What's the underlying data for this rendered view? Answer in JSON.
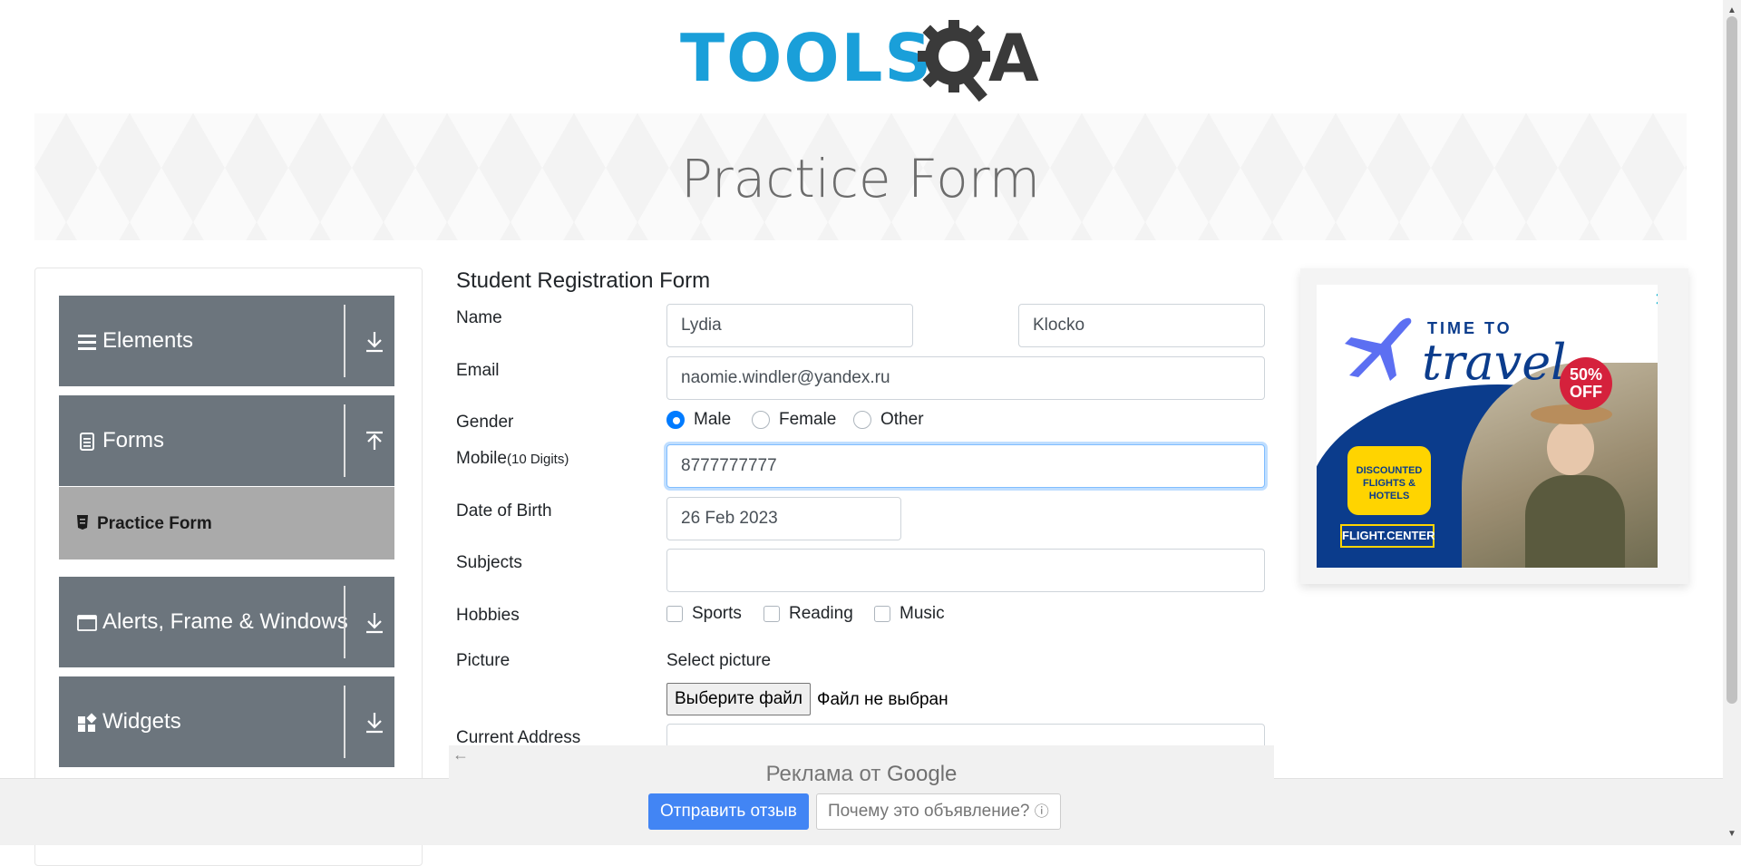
{
  "header": {
    "logo_main": "TOOLS",
    "logo_end": "A"
  },
  "banner": {
    "title": "Practice Form"
  },
  "sidebar": {
    "groups": [
      {
        "label": "Elements",
        "icon": "list-icon",
        "expanded": false
      },
      {
        "label": "Forms",
        "icon": "document-icon",
        "expanded": true
      },
      {
        "label": "Alerts, Frame & Windows",
        "icon": "window-icon",
        "expanded": false
      },
      {
        "label": "Widgets",
        "icon": "widgets-icon",
        "expanded": false
      }
    ],
    "active_item": {
      "label": "Practice Form",
      "icon": "form-icon"
    }
  },
  "form": {
    "title": "Student Registration Form",
    "name_label": "Name",
    "first_name": "Lydia",
    "last_name": "Klocko",
    "email_label": "Email",
    "email": "naomie.windler@yandex.ru",
    "gender_label": "Gender",
    "gender_options": [
      "Male",
      "Female",
      "Other"
    ],
    "gender_selected": "Male",
    "mobile_label": "Mobile",
    "mobile_hint": "(10 Digits)",
    "mobile": "8777777777",
    "dob_label": "Date of Birth",
    "dob": "26 Feb 2023",
    "subjects_label": "Subjects",
    "hobbies_label": "Hobbies",
    "hobbies": [
      "Sports",
      "Reading",
      "Music"
    ],
    "picture_label": "Picture",
    "picture_prompt": "Select picture",
    "file_button": "Выберите файл",
    "file_status": "Файл не выбран",
    "address_label": "Current Address"
  },
  "ad": {
    "close": "✕",
    "time_to": "TIME TO",
    "travel": "travel",
    "badge": "50% OFF",
    "promo": "DISCOUNTED FLIGHTS & HOTELS",
    "brand": "FLIGHT.CENTER"
  },
  "google_bar": {
    "back": "←",
    "heading_prefix": "Реклама от",
    "heading_brand": "Google",
    "send_feedback": "Отправить отзыв",
    "why_ad": "Почему это объявление?",
    "info": "ⓘ"
  },
  "colors": {
    "accent": "#007bff",
    "sidebar": "#6c757d",
    "sidebar_active": "#aaaaaa",
    "logo_blue": "#1a9fd9"
  }
}
